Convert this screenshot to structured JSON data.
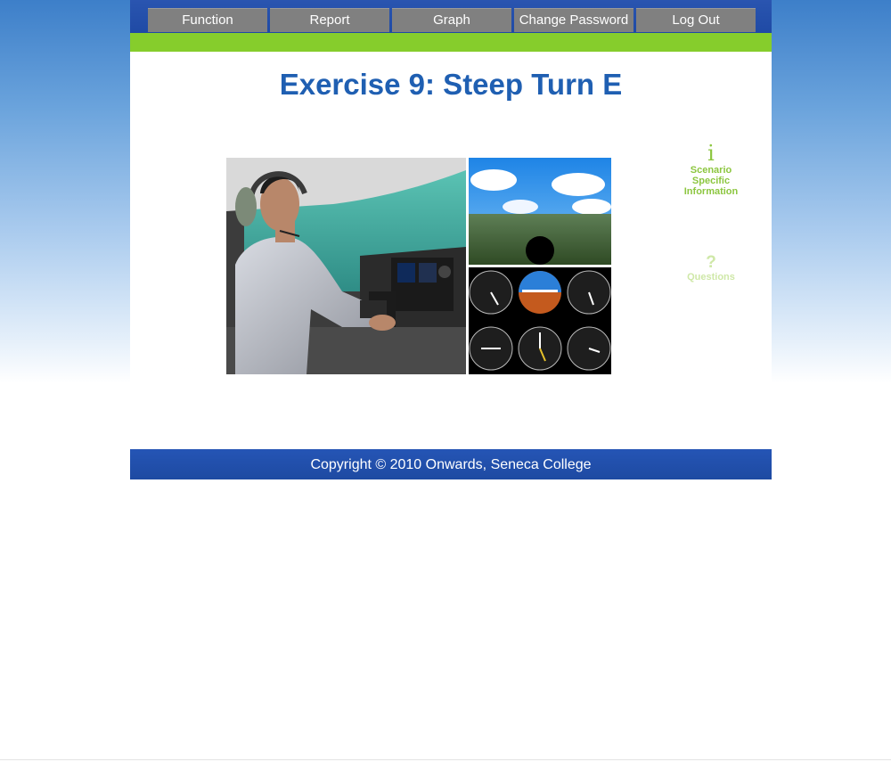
{
  "nav": {
    "items": [
      {
        "label": "Function"
      },
      {
        "label": "Report"
      },
      {
        "label": "Graph"
      },
      {
        "label": "Change Password"
      },
      {
        "label": "Log Out"
      }
    ]
  },
  "main": {
    "title": "Exercise 9: Steep Turn E",
    "image_alt": "Pilot in flight simulator cockpit with outside view and flight instruments"
  },
  "side_links": {
    "info": {
      "icon": "i",
      "label_lines": [
        "Scenario",
        "Specific",
        "Information"
      ]
    },
    "questions": {
      "icon": "?",
      "label": "Questions"
    }
  },
  "footer": {
    "text": "Copyright © 2010 Onwards, Seneca College"
  },
  "colors": {
    "nav_bg": "#1f4aa5",
    "nav_button": "#808080",
    "accent_green": "#86cd2c",
    "title_blue": "#1f5fb2",
    "footer_bg": "#2254b3"
  }
}
